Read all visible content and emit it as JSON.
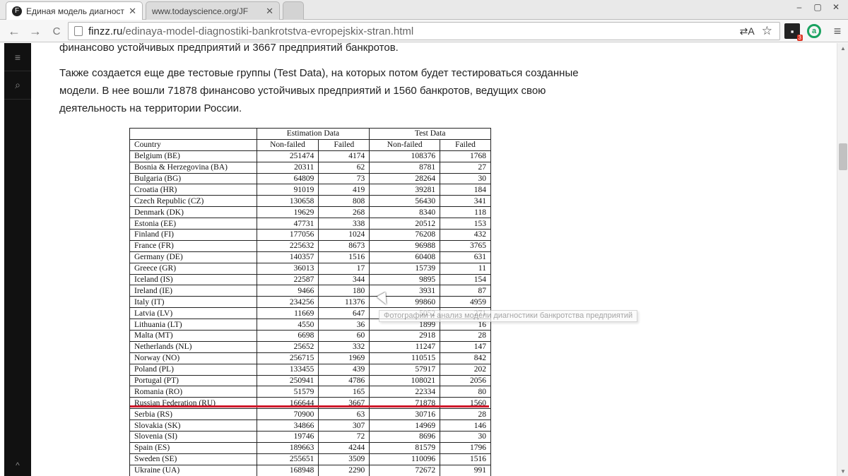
{
  "browser": {
    "tabs": [
      {
        "title": "Единая модель диагност",
        "close": "✕",
        "favicon": "F"
      },
      {
        "title": "www.todayscience.org/JF",
        "close": "✕"
      }
    ],
    "url_host": "finzz.ru",
    "url_path": "/edinaya-model-diagnostiki-bankrotstva-evropejskix-stran.html",
    "nav": {
      "back": "←",
      "forward": "→",
      "reload": "C"
    },
    "icons": {
      "translate": "⇄A",
      "star": "☆",
      "cast_badge": "3",
      "ext_letter": "a",
      "menu": "≡"
    }
  },
  "sidebar": {
    "items": [
      "≡",
      "⌕"
    ],
    "bottom": "^"
  },
  "article": {
    "line1": "финансово устойчивых предприятий и 3667 предприятий банкротов.",
    "para2": "Также создается еще две тестовые группы (Test Data), на которых потом будет тестироваться созданные модели. В нее вошли 71878 финансово устойчивых предприятий и 1560 банкротов, ведущих свою деятельность на территории России."
  },
  "table": {
    "group_headers": [
      "Estimation Data",
      "Test Data"
    ],
    "columns": [
      "Country",
      "Non-failed",
      "Failed",
      "Non-failed",
      "Failed"
    ],
    "rows": [
      [
        "Belgium (BE)",
        "251474",
        "4174",
        "108376",
        "1768"
      ],
      [
        "Bosnia & Herzegovina (BA)",
        "20311",
        "62",
        "8781",
        "27"
      ],
      [
        "Bulgaria (BG)",
        "64809",
        "73",
        "28264",
        "30"
      ],
      [
        "Croatia (HR)",
        "91019",
        "419",
        "39281",
        "184"
      ],
      [
        "Czech Republic (CZ)",
        "130658",
        "808",
        "56430",
        "341"
      ],
      [
        "Denmark (DK)",
        "19629",
        "268",
        "8340",
        "118"
      ],
      [
        "Estonia (EE)",
        "47731",
        "338",
        "20512",
        "153"
      ],
      [
        "Finland (FI)",
        "177056",
        "1024",
        "76208",
        "432"
      ],
      [
        "France (FR)",
        "225632",
        "8673",
        "96988",
        "3765"
      ],
      [
        "Germany (DE)",
        "140357",
        "1516",
        "60408",
        "631"
      ],
      [
        "Greece (GR)",
        "36013",
        "17",
        "15739",
        "11"
      ],
      [
        "Iceland (IS)",
        "22587",
        "344",
        "9895",
        "154"
      ],
      [
        "Ireland (IE)",
        "9466",
        "180",
        "3931",
        "87"
      ],
      [
        "Italy (IT)",
        "234256",
        "11376",
        "99860",
        "4959"
      ],
      [
        "Latvia (LV)",
        "11669",
        "647",
        "5052",
        "271"
      ],
      [
        "Lithuania (LT)",
        "4550",
        "36",
        "1899",
        "16"
      ],
      [
        "Malta (MT)",
        "6698",
        "60",
        "2918",
        "28"
      ],
      [
        "Netherlands (NL)",
        "25652",
        "332",
        "11247",
        "147"
      ],
      [
        "Norway (NO)",
        "256715",
        "1969",
        "110515",
        "842"
      ],
      [
        "Poland (PL)",
        "133455",
        "439",
        "57917",
        "202"
      ],
      [
        "Portugal (PT)",
        "250941",
        "4786",
        "108021",
        "2056"
      ],
      [
        "Romania (RO)",
        "51579",
        "165",
        "22334",
        "80"
      ],
      [
        "Russian Federation (RU)",
        "166644",
        "3667",
        "71878",
        "1560"
      ],
      [
        "Serbia (RS)",
        "70900",
        "63",
        "30716",
        "28"
      ],
      [
        "Slovakia (SK)",
        "34866",
        "307",
        "14969",
        "146"
      ],
      [
        "Slovenia (SI)",
        "19746",
        "72",
        "8696",
        "30"
      ],
      [
        "Spain (ES)",
        "189663",
        "4244",
        "81579",
        "1796"
      ],
      [
        "Sweden (SE)",
        "255651",
        "3509",
        "110096",
        "1516"
      ],
      [
        "Ukraine (UA)",
        "168948",
        "2290",
        "72672",
        "991"
      ]
    ],
    "highlight_color": "#d0192b"
  },
  "tooltip": "Фотографии и анализ модели диагностики банкротства предприятий"
}
